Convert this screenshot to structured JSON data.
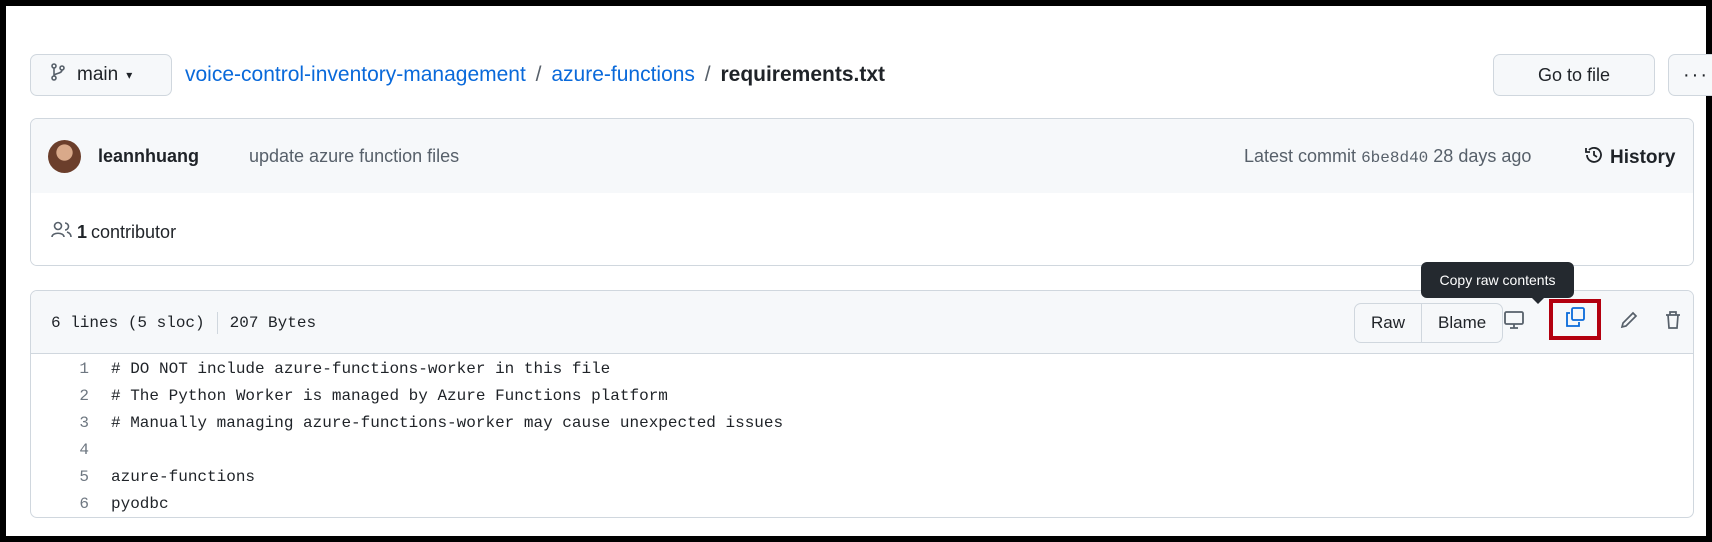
{
  "branch": {
    "name": "main"
  },
  "breadcrumb": {
    "repo": "voice-control-inventory-management",
    "folder": "azure-functions",
    "file": "requirements.txt",
    "separator": "/"
  },
  "actions": {
    "goto_file": "Go to file",
    "more": "···"
  },
  "commit": {
    "author": "leannhuang",
    "message": "update azure function files",
    "latest_label": "Latest commit",
    "sha": "6be8d40",
    "age": "28 days ago",
    "history_label": "History"
  },
  "contributors": {
    "count": "1",
    "label": "contributor"
  },
  "file": {
    "lines_info": "6 lines (5 sloc)",
    "size": "207 Bytes",
    "raw_label": "Raw",
    "blame_label": "Blame",
    "tooltip": "Copy raw contents",
    "lines": [
      {
        "num": "1",
        "text": "# DO NOT include azure-functions-worker in this file"
      },
      {
        "num": "2",
        "text": "# The Python Worker is managed by Azure Functions platform"
      },
      {
        "num": "3",
        "text": "# Manually managing azure-functions-worker may cause unexpected issues"
      },
      {
        "num": "4",
        "text": ""
      },
      {
        "num": "5",
        "text": "azure-functions"
      },
      {
        "num": "6",
        "text": "pyodbc"
      }
    ]
  },
  "colors": {
    "link": "#0969da",
    "highlight": "#b3000f",
    "tooltip_bg": "#24292f"
  },
  "icons": [
    "branch-icon",
    "caret-down-icon",
    "history-icon",
    "people-icon",
    "display-icon",
    "copy-icon",
    "pencil-icon",
    "trash-icon"
  ]
}
